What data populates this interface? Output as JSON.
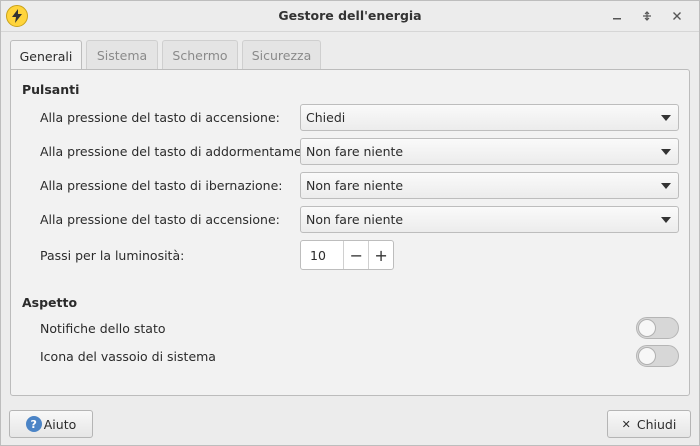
{
  "window": {
    "title": "Gestore dell'energia",
    "icon": "lightning-bolt-icon"
  },
  "tabs": [
    {
      "label": "Generali",
      "active": true
    },
    {
      "label": "Sistema",
      "active": false
    },
    {
      "label": "Schermo",
      "active": false
    },
    {
      "label": "Sicurezza",
      "active": false
    }
  ],
  "buttons_section": {
    "title": "Pulsanti",
    "rows": [
      {
        "label": "Alla pressione del tasto di accensione:",
        "value": "Chiedi"
      },
      {
        "label": "Alla pressione del tasto di addormentamento:",
        "value": "Non fare niente"
      },
      {
        "label": "Alla pressione del tasto di ibernazione:",
        "value": "Non fare niente"
      },
      {
        "label": "Alla pressione del tasto di accensione:",
        "value": "Non fare niente"
      }
    ],
    "brightness": {
      "label": "Passi per la luminosità:",
      "value": "10",
      "minus": "−",
      "plus": "+"
    }
  },
  "appearance": {
    "title": "Aspetto",
    "notifications": {
      "label": "Notifiche dello stato",
      "on": false
    },
    "tray_icon": {
      "label": "Icona del vassoio di sistema",
      "on": false
    }
  },
  "footer": {
    "help_label": "Aiuto",
    "close_label": "Chiudi"
  },
  "colors": {
    "accent": "#4b84c6",
    "app_icon": "#ffd43b"
  }
}
